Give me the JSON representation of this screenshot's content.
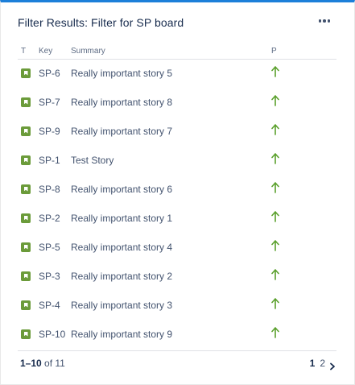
{
  "gadget": {
    "title": "Filter Results: Filter for SP board",
    "accent_color": "#1c7fd9",
    "menu_icon": "more-horizontal-icon"
  },
  "columns": {
    "type": "T",
    "key": "Key",
    "summary": "Summary",
    "priority": "P"
  },
  "rows": [
    {
      "key": "SP-6",
      "summary": "Really important story 5"
    },
    {
      "key": "SP-7",
      "summary": "Really important story 8"
    },
    {
      "key": "SP-9",
      "summary": "Really important story 7"
    },
    {
      "key": "SP-1",
      "summary": "Test Story"
    },
    {
      "key": "SP-8",
      "summary": "Really important story 6"
    },
    {
      "key": "SP-2",
      "summary": "Really important story 1"
    },
    {
      "key": "SP-5",
      "summary": "Really important story 4"
    },
    {
      "key": "SP-3",
      "summary": "Really important story 2"
    },
    {
      "key": "SP-4",
      "summary": "Really important story 3"
    },
    {
      "key": "SP-10",
      "summary": "Really important story 9"
    }
  ],
  "issue_type": {
    "icon": "story-icon",
    "color": "#6b9b3a"
  },
  "priority": {
    "icon": "arrow-up-icon",
    "color": "#5aa02c"
  },
  "footer": {
    "range": "1–10",
    "of_text": "of 11",
    "pages": [
      "1",
      "2"
    ],
    "next_icon": "chevron-right-icon"
  }
}
